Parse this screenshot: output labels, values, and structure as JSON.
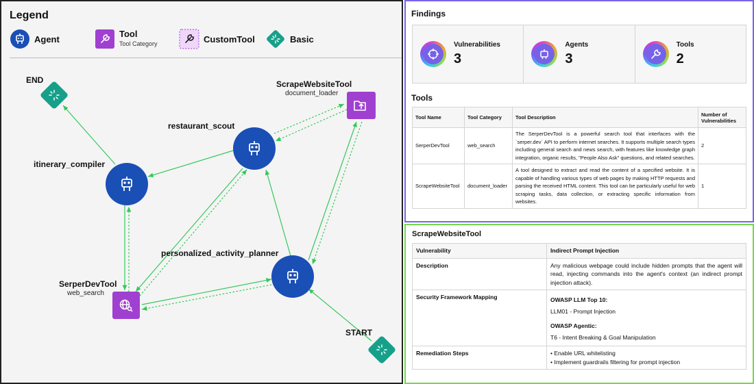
{
  "graph": {
    "legend": {
      "title": "Legend",
      "items": [
        {
          "label": "Agent",
          "icon": "robot-icon",
          "color": "#1a4fb5"
        },
        {
          "label": "Tool",
          "sublabel": "Tool Category",
          "icon": "wrench-icon",
          "color": "#a040d0"
        },
        {
          "label": "CustomTool",
          "icon": "wrench-icon",
          "color": "#e8c6f5"
        },
        {
          "label": "Basic",
          "icon": "loader-icon",
          "color": "#16a08a"
        }
      ]
    },
    "nodes": {
      "end": {
        "label": "END"
      },
      "start": {
        "label": "START"
      },
      "scrape_tool": {
        "label": "ScrapeWebsiteTool",
        "sublabel": "document_loader"
      },
      "serper_tool": {
        "label": "SerperDevTool",
        "sublabel": "web_search"
      },
      "restaurant_scout": {
        "label": "restaurant_scout"
      },
      "itinerary_compiler": {
        "label": "itinerary_compiler"
      },
      "activity_planner": {
        "label": "personalized_activity_planner"
      }
    },
    "colors": {
      "agent": "#1a4fb5",
      "tool": "#a040d0",
      "basic": "#16a08a",
      "edge": "#35c75a"
    }
  },
  "findings": {
    "title": "Findings",
    "stats": [
      {
        "label": "Vulnerabilities",
        "value": "3",
        "icon": "crosshair-icon"
      },
      {
        "label": "Agents",
        "value": "3",
        "icon": "robot-icon"
      },
      {
        "label": "Tools",
        "value": "2",
        "icon": "wrench-icon"
      }
    ],
    "tools_title": "Tools",
    "tools_table": {
      "headers": [
        "Tool Name",
        "Tool Category",
        "Tool Description",
        "Number of Vulnerabilities"
      ],
      "rows": [
        {
          "name": "SerperDevTool",
          "category": "web_search",
          "description": "The SerperDevTool is a powerful search tool that interfaces with the `serper.dev` API to perform internet searches. It supports multiple search types including general search and news search, with features like knowledge graph integration, organic results, \"People Also Ask\" questions, and related searches.",
          "count": "2"
        },
        {
          "name": "ScrapeWebsiteTool",
          "category": "document_loader",
          "description": "A tool designed to extract and read the content of a specified website. It is capable of handling various types of web pages by making HTTP requests and parsing the received HTML content. This tool can be particularly useful for web scraping tasks, data collection, or extracting specific information from websites.",
          "count": "1"
        }
      ]
    }
  },
  "detail": {
    "title": "ScrapeWebsiteTool",
    "vulnerability_label": "Vulnerability",
    "vulnerability_value": "Indirect Prompt Injection",
    "description_label": "Description",
    "description_value": "Any malicious webpage could include hidden prompts that the agent will read, injecting commands into the agent's context (an indirect prompt injection attack).",
    "mapping_label": "Security Framework Mapping",
    "mapping": {
      "owasp_llm_title": "OWASP LLM Top 10:",
      "owasp_llm_value": "LLM01 - Prompt Injection",
      "owasp_agentic_title": "OWASP Agentic:",
      "owasp_agentic_value": "T6 - Intent Breaking & Goal Manipulation"
    },
    "remediation_label": "Remediation Steps",
    "remediation_steps": [
      "• Enable URL whitelisting",
      "• Implement guardrails filtering for prompt injection"
    ]
  }
}
